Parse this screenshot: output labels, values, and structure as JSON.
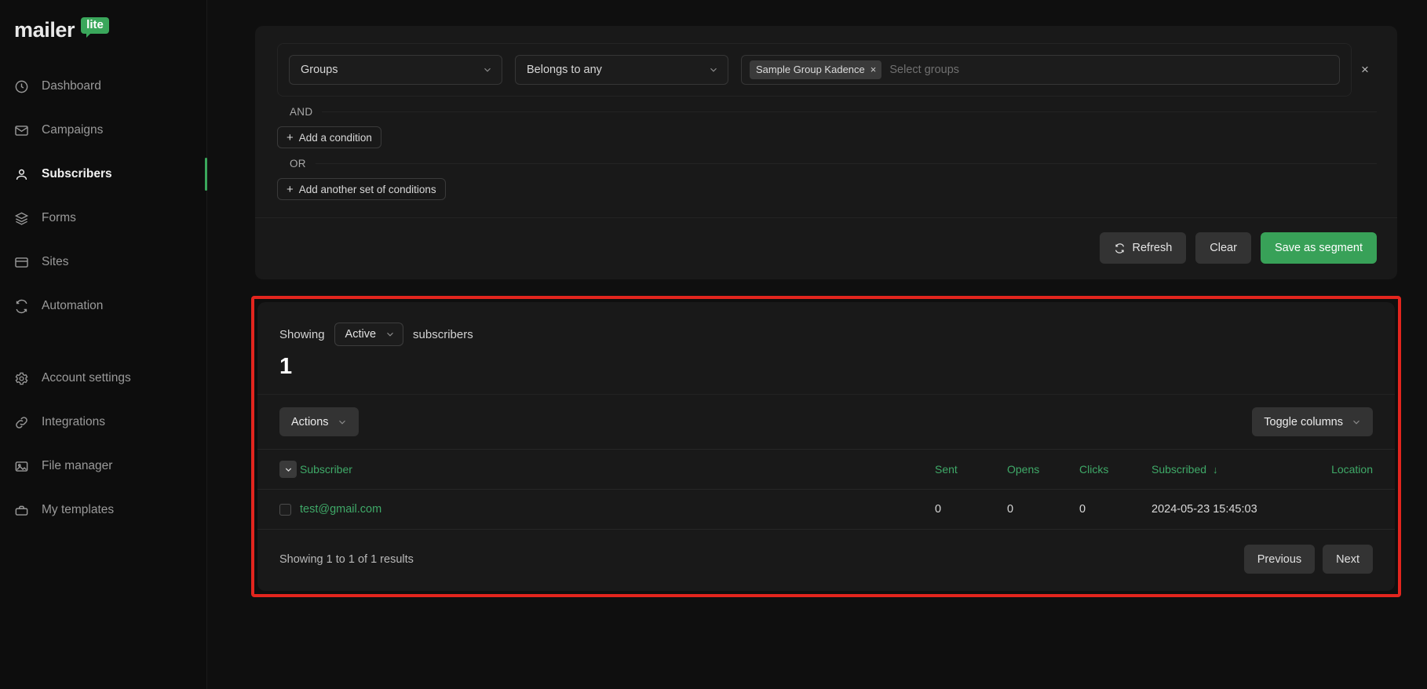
{
  "brand": {
    "name": "mailer",
    "badge": "lite",
    "accent": "#3aa75b"
  },
  "sidebar": {
    "items": [
      {
        "label": "Dashboard",
        "icon": "clock-icon",
        "active": false
      },
      {
        "label": "Campaigns",
        "icon": "envelope-icon",
        "active": false
      },
      {
        "label": "Subscribers",
        "icon": "user-icon",
        "active": true
      },
      {
        "label": "Forms",
        "icon": "layers-icon",
        "active": false
      },
      {
        "label": "Sites",
        "icon": "browser-icon",
        "active": false
      },
      {
        "label": "Automation",
        "icon": "refresh-icon",
        "active": false
      }
    ],
    "items_secondary": [
      {
        "label": "Account settings",
        "icon": "gear-icon",
        "active": false
      },
      {
        "label": "Integrations",
        "icon": "link-icon",
        "active": false
      },
      {
        "label": "File manager",
        "icon": "image-icon",
        "active": false
      },
      {
        "label": "My templates",
        "icon": "briefcase-icon",
        "active": false
      }
    ]
  },
  "filter": {
    "field_select": "Groups",
    "operator_select": "Belongs to any",
    "tags": [
      "Sample Group Kadence"
    ],
    "tag_remove_label": "×",
    "groups_placeholder": "Select groups",
    "remove_condition_label": "×",
    "and_label": "AND",
    "or_label": "OR",
    "add_condition_label": "Add a condition",
    "add_set_label": "Add another set of conditions",
    "plus_glyph": "+",
    "refresh_label": "Refresh",
    "clear_label": "Clear",
    "save_segment_label": "Save as segment",
    "save_color": "#38a158"
  },
  "subscribers": {
    "showing_prefix": "Showing",
    "status_filter": "Active",
    "showing_suffix": "subscribers",
    "count": "1",
    "actions_label": "Actions",
    "toggle_columns_label": "Toggle columns",
    "columns": [
      "Subscriber",
      "Sent",
      "Opens",
      "Clicks",
      "Subscribed",
      "Location"
    ],
    "sort_column": "Subscribed",
    "sort_arrow": "↓",
    "rows": [
      {
        "subscriber": "test@gmail.com",
        "sent": "0",
        "opens": "0",
        "clicks": "0",
        "subscribed": "2024-05-23 15:45:03",
        "location": ""
      }
    ],
    "results_text": "Showing 1 to 1 of 1 results",
    "previous_label": "Previous",
    "next_label": "Next",
    "link_color": "#3fa968"
  },
  "highlight": {
    "color": "#e3251e"
  }
}
